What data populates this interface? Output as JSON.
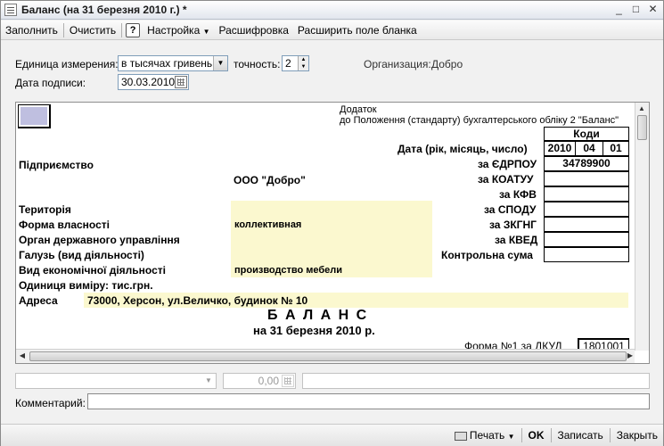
{
  "window": {
    "title": "Баланс (на 31 березня 2010 г.) *",
    "minimize": "_",
    "maximize": "□",
    "close": "✕"
  },
  "toolbar": {
    "fill": "Заполнить",
    "clear": "Очистить",
    "help": "?",
    "settings": "Настройка",
    "decode": "Расшифровка",
    "expand": "Расширить поле бланка"
  },
  "form": {
    "unit_label": "Единица измерения:",
    "unit_value": "в тысячах гривень",
    "precision_label": "точность:",
    "precision_value": "2",
    "org_label": "Организация:",
    "org_value": "Добро",
    "date_label": "Дата подписи:",
    "date_value": "30.03.2010"
  },
  "sheet": {
    "appendix": "Додаток",
    "regulation": "до Положення (стандарту) бухгалтерського обліку 2 \"Баланс\"",
    "codes_header": "Коди",
    "date_label": "Дата (рік, місяць, число)",
    "year": "2010",
    "month": "04",
    "day": "01",
    "edrpou_label": "за ЄДРПОУ",
    "edrpou_value": "34789900",
    "koatuu_label": "за КОАТУУ",
    "kfv_label": "за КФВ",
    "spodu_label": "за СПОДУ",
    "zkgng_label": "за ЗКГНГ",
    "kved_label": "за КВЕД",
    "control_label": "Контрольна сума",
    "enterprise_label": "Підприємство",
    "enterprise_value": "ООО \"Добро\"",
    "territory_label": "Територія",
    "ownership_label": "Форма власності",
    "ownership_value": "коллективная",
    "gov_label": "Орган державного управління",
    "branch_label": "Галузь (вид діяльності)",
    "activity_label": "Вид економічної діяльності",
    "activity_value": "производство мебели",
    "measure_label": "Одиниця виміру: тис.грн.",
    "address_label": "Адреса",
    "address_value": "73000, Херсон, ул.Величко, будинок № 10",
    "balance_title": "Б А Л А Н С",
    "balance_date": "на 31 березня 2010 р.",
    "form_label": "Форма №1 за ДКУД",
    "form_code": "1801001"
  },
  "below": {
    "amount": "0,00",
    "comment_label": "Комментарий:"
  },
  "status": {
    "print": "Печать",
    "ok": "OK",
    "save": "Записать",
    "close": "Закрыть"
  }
}
